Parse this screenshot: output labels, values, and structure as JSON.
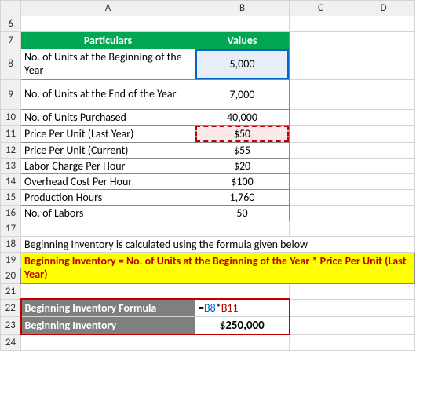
{
  "columns": [
    "A",
    "B",
    "C",
    "D"
  ],
  "rows_shown": [
    "6",
    "7",
    "8",
    "9",
    "10",
    "11",
    "12",
    "13",
    "14",
    "15",
    "16",
    "17",
    "18",
    "19",
    "20",
    "21",
    "22",
    "23",
    "24"
  ],
  "header": {
    "particulars": "Particulars",
    "values": "Values"
  },
  "table": [
    {
      "label": "No. of Units at the Beginning of the Year",
      "value": "5,000"
    },
    {
      "label": "No. of Units at the End of the Year",
      "value": "7,000"
    },
    {
      "label": "No. of Units Purchased",
      "value": "40,000"
    },
    {
      "label": "Price Per Unit (Last Year)",
      "value": "$50"
    },
    {
      "label": "Price Per Unit (Current)",
      "value": "$55"
    },
    {
      "label": "Labor Charge Per Hour",
      "value": "$20"
    },
    {
      "label": "Overhead Cost Per Hour",
      "value": "$100"
    },
    {
      "label": "Production Hours",
      "value": "1,760"
    },
    {
      "label": "No. of Labors",
      "value": "50"
    }
  ],
  "note": "Beginning Inventory is calculated using the formula given below",
  "formula_desc": "Beginning Inventory = No. of Units at the Beginning of the Year * Price Per Unit (Last Year)",
  "result_block": {
    "formula_label": "Beginning Inventory Formula",
    "formula_eq": "=",
    "formula_ref1": "B8",
    "formula_op": "*",
    "formula_ref2": "B11",
    "result_label": "Beginning Inventory",
    "result_value": "$250,000"
  },
  "chart_data": {
    "type": "table",
    "title": "Beginning Inventory calculation inputs",
    "rows": [
      {
        "particular": "No. of Units at the Beginning of the Year",
        "value": 5000
      },
      {
        "particular": "No. of Units at the End of the Year",
        "value": 7000
      },
      {
        "particular": "No. of Units Purchased",
        "value": 40000
      },
      {
        "particular": "Price Per Unit (Last Year)",
        "value": 50
      },
      {
        "particular": "Price Per Unit (Current)",
        "value": 55
      },
      {
        "particular": "Labor Charge Per Hour",
        "value": 20
      },
      {
        "particular": "Overhead Cost Per Hour",
        "value": 100
      },
      {
        "particular": "Production Hours",
        "value": 1760
      },
      {
        "particular": "No. of Labors",
        "value": 50
      }
    ],
    "formula": "Beginning Inventory = No. of Units at the Beginning of the Year * Price Per Unit (Last Year)",
    "result": 250000
  }
}
